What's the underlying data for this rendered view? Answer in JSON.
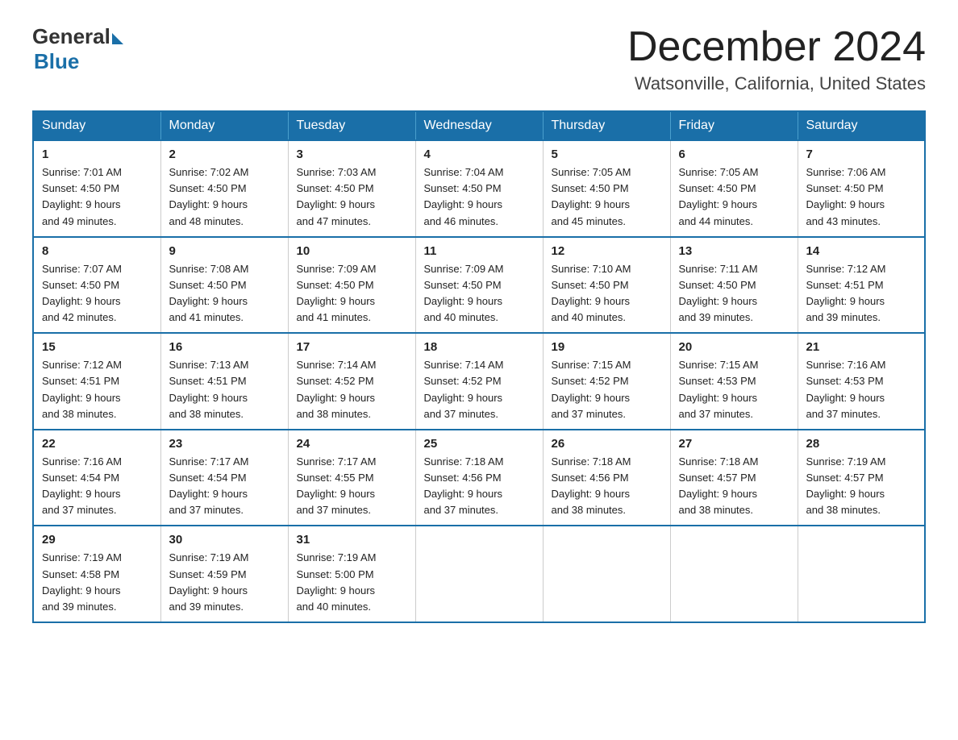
{
  "logo": {
    "general": "General",
    "blue": "Blue"
  },
  "header": {
    "month": "December 2024",
    "location": "Watsonville, California, United States"
  },
  "days_of_week": [
    "Sunday",
    "Monday",
    "Tuesday",
    "Wednesday",
    "Thursday",
    "Friday",
    "Saturday"
  ],
  "weeks": [
    [
      {
        "day": "1",
        "sunrise": "7:01 AM",
        "sunset": "4:50 PM",
        "daylight": "9 hours and 49 minutes."
      },
      {
        "day": "2",
        "sunrise": "7:02 AM",
        "sunset": "4:50 PM",
        "daylight": "9 hours and 48 minutes."
      },
      {
        "day": "3",
        "sunrise": "7:03 AM",
        "sunset": "4:50 PM",
        "daylight": "9 hours and 47 minutes."
      },
      {
        "day": "4",
        "sunrise": "7:04 AM",
        "sunset": "4:50 PM",
        "daylight": "9 hours and 46 minutes."
      },
      {
        "day": "5",
        "sunrise": "7:05 AM",
        "sunset": "4:50 PM",
        "daylight": "9 hours and 45 minutes."
      },
      {
        "day": "6",
        "sunrise": "7:05 AM",
        "sunset": "4:50 PM",
        "daylight": "9 hours and 44 minutes."
      },
      {
        "day": "7",
        "sunrise": "7:06 AM",
        "sunset": "4:50 PM",
        "daylight": "9 hours and 43 minutes."
      }
    ],
    [
      {
        "day": "8",
        "sunrise": "7:07 AM",
        "sunset": "4:50 PM",
        "daylight": "9 hours and 42 minutes."
      },
      {
        "day": "9",
        "sunrise": "7:08 AM",
        "sunset": "4:50 PM",
        "daylight": "9 hours and 41 minutes."
      },
      {
        "day": "10",
        "sunrise": "7:09 AM",
        "sunset": "4:50 PM",
        "daylight": "9 hours and 41 minutes."
      },
      {
        "day": "11",
        "sunrise": "7:09 AM",
        "sunset": "4:50 PM",
        "daylight": "9 hours and 40 minutes."
      },
      {
        "day": "12",
        "sunrise": "7:10 AM",
        "sunset": "4:50 PM",
        "daylight": "9 hours and 40 minutes."
      },
      {
        "day": "13",
        "sunrise": "7:11 AM",
        "sunset": "4:50 PM",
        "daylight": "9 hours and 39 minutes."
      },
      {
        "day": "14",
        "sunrise": "7:12 AM",
        "sunset": "4:51 PM",
        "daylight": "9 hours and 39 minutes."
      }
    ],
    [
      {
        "day": "15",
        "sunrise": "7:12 AM",
        "sunset": "4:51 PM",
        "daylight": "9 hours and 38 minutes."
      },
      {
        "day": "16",
        "sunrise": "7:13 AM",
        "sunset": "4:51 PM",
        "daylight": "9 hours and 38 minutes."
      },
      {
        "day": "17",
        "sunrise": "7:14 AM",
        "sunset": "4:52 PM",
        "daylight": "9 hours and 38 minutes."
      },
      {
        "day": "18",
        "sunrise": "7:14 AM",
        "sunset": "4:52 PM",
        "daylight": "9 hours and 37 minutes."
      },
      {
        "day": "19",
        "sunrise": "7:15 AM",
        "sunset": "4:52 PM",
        "daylight": "9 hours and 37 minutes."
      },
      {
        "day": "20",
        "sunrise": "7:15 AM",
        "sunset": "4:53 PM",
        "daylight": "9 hours and 37 minutes."
      },
      {
        "day": "21",
        "sunrise": "7:16 AM",
        "sunset": "4:53 PM",
        "daylight": "9 hours and 37 minutes."
      }
    ],
    [
      {
        "day": "22",
        "sunrise": "7:16 AM",
        "sunset": "4:54 PM",
        "daylight": "9 hours and 37 minutes."
      },
      {
        "day": "23",
        "sunrise": "7:17 AM",
        "sunset": "4:54 PM",
        "daylight": "9 hours and 37 minutes."
      },
      {
        "day": "24",
        "sunrise": "7:17 AM",
        "sunset": "4:55 PM",
        "daylight": "9 hours and 37 minutes."
      },
      {
        "day": "25",
        "sunrise": "7:18 AM",
        "sunset": "4:56 PM",
        "daylight": "9 hours and 37 minutes."
      },
      {
        "day": "26",
        "sunrise": "7:18 AM",
        "sunset": "4:56 PM",
        "daylight": "9 hours and 38 minutes."
      },
      {
        "day": "27",
        "sunrise": "7:18 AM",
        "sunset": "4:57 PM",
        "daylight": "9 hours and 38 minutes."
      },
      {
        "day": "28",
        "sunrise": "7:19 AM",
        "sunset": "4:57 PM",
        "daylight": "9 hours and 38 minutes."
      }
    ],
    [
      {
        "day": "29",
        "sunrise": "7:19 AM",
        "sunset": "4:58 PM",
        "daylight": "9 hours and 39 minutes."
      },
      {
        "day": "30",
        "sunrise": "7:19 AM",
        "sunset": "4:59 PM",
        "daylight": "9 hours and 39 minutes."
      },
      {
        "day": "31",
        "sunrise": "7:19 AM",
        "sunset": "5:00 PM",
        "daylight": "9 hours and 40 minutes."
      },
      null,
      null,
      null,
      null
    ]
  ],
  "labels": {
    "sunrise": "Sunrise:",
    "sunset": "Sunset:",
    "daylight": "Daylight:"
  }
}
